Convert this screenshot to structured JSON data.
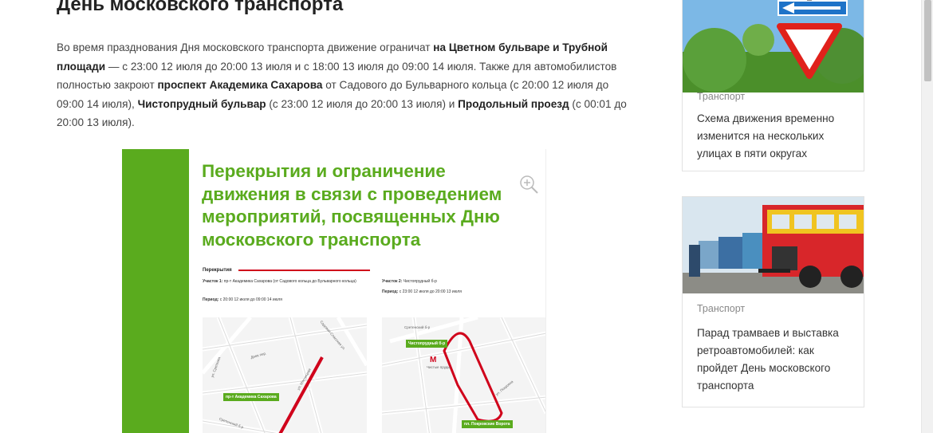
{
  "article": {
    "title": "День московского транспорта",
    "p1": "Во время празднования Дня московского транспорта движение ограничат ",
    "b1": "на Цветном бульваре и Трубной площади",
    "p2": " — с 23:00 12 июля до 20:00 13 июля и с 18:00 13 июля до 09:00 14 июля. Также для автомобилистов полностью закроют ",
    "b2": "проспект Академика Сахарова",
    "p3": " от Садового до Бульварного кольца (с 20:00 12 июля до 09:00 14 июля), ",
    "b3": "Чистопрудный бульвар",
    "p4": " (с 23:00 12 июля до 20:00 13 июля) и ",
    "b4": "Продольный проезд",
    "p5": " (с 00:01 до 20:00 13 июля)."
  },
  "infographic": {
    "title": "Перекрытия и ограничение движения в связи с проведением мероприятий, посвященных Дню московского транспорта",
    "zoom_icon": "zoom-in-icon",
    "section_label": "Перекрытия",
    "plot1_label": "Участок 1:",
    "plot1_text": "пр-т Академика Сахарова (от Садового кольца до Бульварного кольца)",
    "plot1_period_label": "Период:",
    "plot1_period": "с 20:00 12 июля до 09:00 14 июля",
    "plot2_label": "Участок 2:",
    "plot2_text": "Чистопрудный б-р",
    "plot2_period_label": "Период:",
    "plot2_period": "с 23:00 12 июля до 20:00 13 июля",
    "map1_label": "пр-т Академика Сахарова",
    "map2_label_top": "Чистопрудный б-р",
    "map2_label_bottom": "пл. Покровские Ворота",
    "map1_street1": "Садовая-Спасская ул.",
    "map1_street2": "Сретенский б-р",
    "map1_street3": "Даев пер.",
    "map1_street4": "ул. Сретенка",
    "map1_street5": "ул. Мясницкая",
    "map2_street1": "Сретенский б-р",
    "map2_street2": "Чистые пруды",
    "map2_street3": "ул. Покровка"
  },
  "cards": [
    {
      "category": "Транспорт",
      "title": "Схема движения временно изменится на нескольких улицах в пяти округах"
    },
    {
      "category": "Транспорт",
      "title": "Парад трамваев и выставка ретроавтомобилей: как пройдет День московского транспорта"
    }
  ],
  "colors": {
    "accent_green": "#5aab1e",
    "road_red": "#d0021b",
    "sign_blue": "#1e73c8"
  }
}
